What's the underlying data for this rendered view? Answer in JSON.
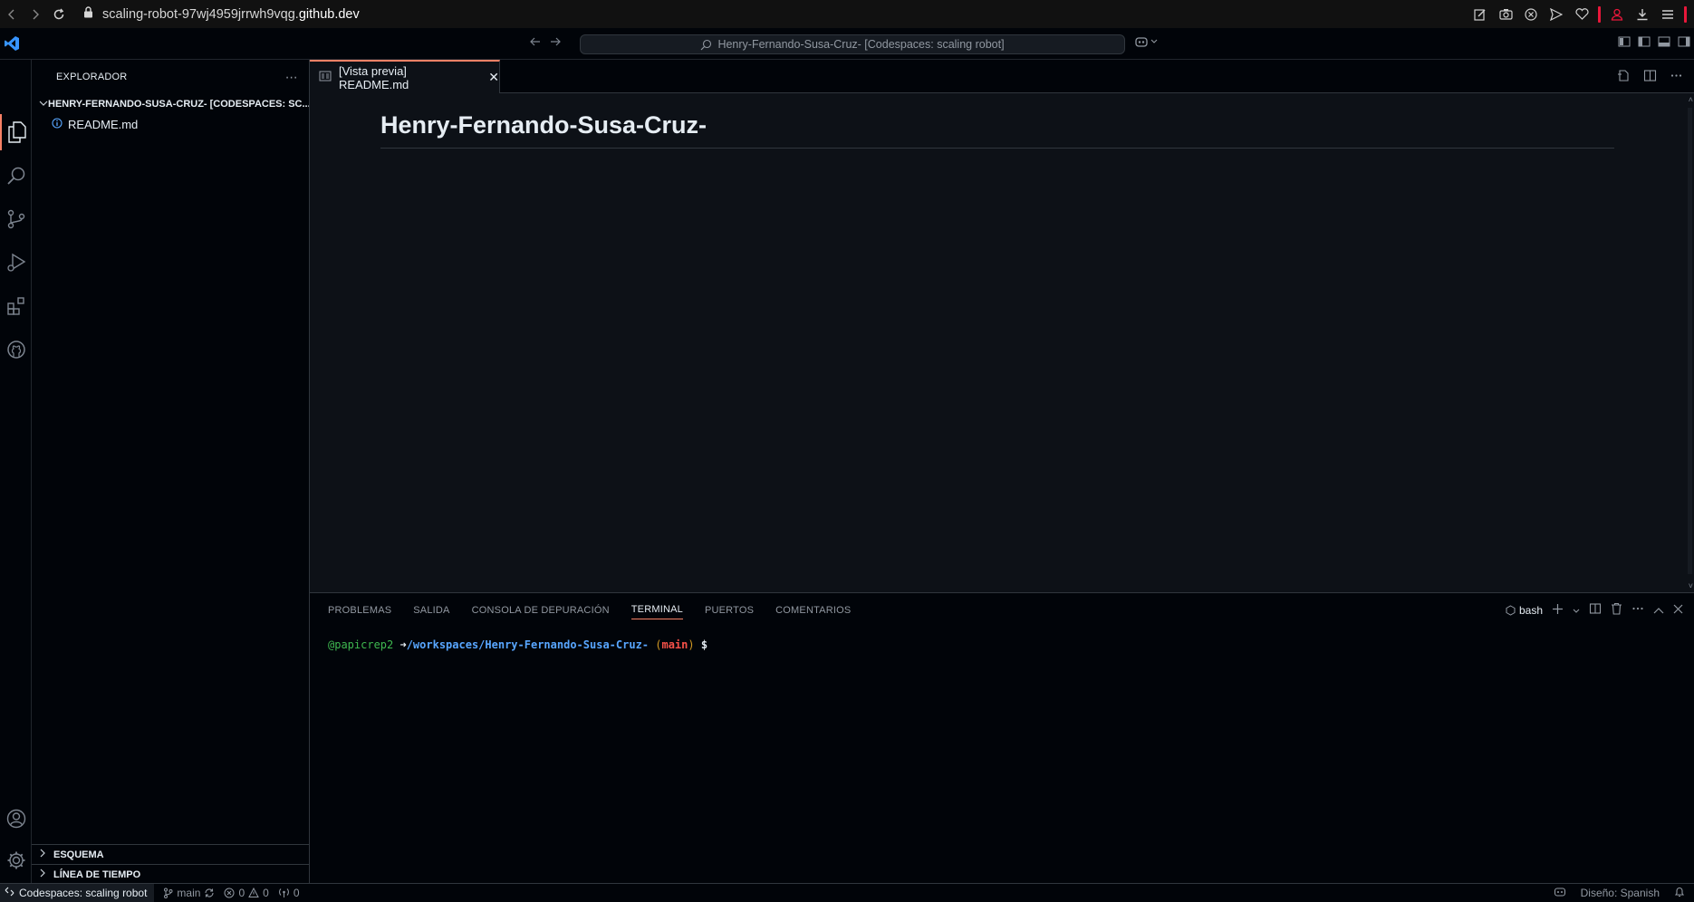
{
  "browser": {
    "url_prefix": "scaling-robot-97wj4959jrrwh9vqg.",
    "url_domain": "github.dev",
    "icons": [
      "edit-icon",
      "camera-icon",
      "shield-icon",
      "send-icon",
      "heart-icon",
      "profile-icon",
      "download-icon",
      "menu-icon"
    ]
  },
  "titlebar": {
    "command_center": "Henry-Fernando-Susa-Cruz- [Codespaces: scaling robot]"
  },
  "sidebar": {
    "title": "EXPLORADOR",
    "more": "⋯",
    "folder": "HENRY-FERNANDO-SUSA-CRUZ- [CODESPACES: SC...",
    "files": [
      {
        "name": "README.md"
      }
    ],
    "sections": [
      "ESQUEMA",
      "LÍNEA DE TIEMPO"
    ]
  },
  "editor": {
    "tab_label": "[Vista previa] README.md",
    "tab_close": "✕",
    "heading": "Henry-Fernando-Susa-Cruz-"
  },
  "panel": {
    "tabs": [
      "PROBLEMAS",
      "SALIDA",
      "CONSOLA DE DEPURACIÓN",
      "TERMINAL",
      "PUERTOS",
      "COMENTARIOS"
    ],
    "active_tab": "TERMINAL",
    "shell": "bash",
    "terminal": {
      "user": "@papicrep2",
      "arrow": " ➜",
      "path": "/workspaces/Henry-Fernando-Susa-Cruz-",
      "paren_open": " (",
      "branch": "main",
      "paren_close": ")",
      "prompt": " $"
    }
  },
  "statusbar": {
    "remote": "Codespaces: scaling robot",
    "branch": "main",
    "errors": "0",
    "warnings": "0",
    "ports": "0",
    "layout": "Diseño: Spanish"
  },
  "colors": {
    "accent": "#f78166",
    "background": "#0d1117",
    "link": "#58a6ff"
  }
}
